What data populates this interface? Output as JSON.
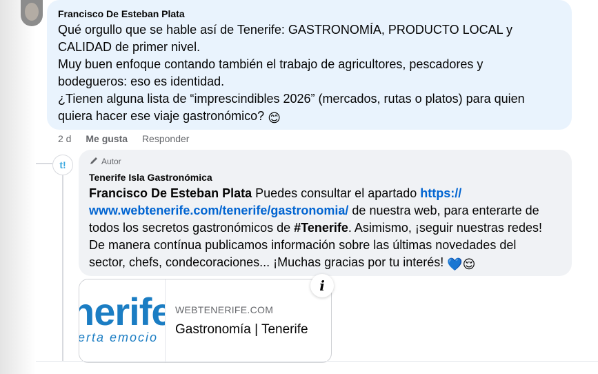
{
  "comment": {
    "author": "Francisco De Esteban Plata",
    "lines": [
      "Qué orgullo que se hable así de Tenerife: GASTRONOMÍA, PRODUCTO LOCAL y",
      "CALIDAD de primer nivel.",
      "Muy buen enfoque contando también el trabajo de agricultores, pescadores y",
      "bodegueros: eso es identidad.",
      "¿Tienen alguna lista de “imprescindibles 2026” (mercados, rutas o platos) para quien",
      "quiera hacer ese viaje gastronómico?"
    ],
    "emoji": "😊",
    "time": "2 d",
    "like_label": "Me gusta",
    "reply_label": "Responder"
  },
  "reply": {
    "avatar_text": "t!",
    "badge": "Autor",
    "author": "Tenerife Isla Gastronómica",
    "mention": "Francisco De Esteban Plata",
    "text_1": " Puedes consultar el apartado ",
    "link_1": "https://",
    "link_2": "www.webtenerife.com/tenerife/gastronomia/",
    "text_2": " de nuestra web, para enterarte de",
    "text_3": "todos los secretos gastronómicos de ",
    "hashtag": "#Tenerife",
    "text_4": ". Asimismo, ¡seguir nuestras redes!",
    "text_5": "De manera contínua publicamos información sobre las últimas novedades del",
    "text_6": "sector, chefs, condecoraciones... ¡Muchas gracias por tu interés!",
    "emojis": "💙😌"
  },
  "link_card": {
    "thumb_big": "nerife",
    "thumb_small": "erta emocio",
    "domain": "WEBTENERIFE.COM",
    "title": "Gastronomía | Tenerife",
    "info_icon": "i"
  },
  "icons": {
    "pencil": "pencil-icon",
    "info": "info-icon"
  },
  "colors": {
    "comment_bubble": "#e9f3fd",
    "reply_bubble": "#f0f2f5",
    "link": "#0064d1",
    "muted": "#65676b"
  }
}
